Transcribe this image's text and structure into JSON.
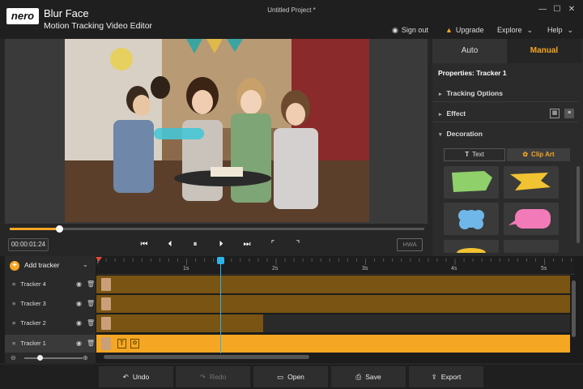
{
  "window": {
    "logo": "nero",
    "app_name": "Blur Face",
    "app_subtitle": "Motion Tracking Video Editor",
    "doc_title": "Untitled Project *",
    "controls": {
      "minimize": "—",
      "maximize": "☐",
      "close": "✕"
    }
  },
  "topnav": {
    "sign_out": "Sign out",
    "upgrade": "Upgrade",
    "explore": "Explore",
    "help": "Help"
  },
  "player": {
    "timecode": "00:00:01:24",
    "hwa": "HWA",
    "progress": 0.12
  },
  "panel": {
    "tab_auto": "Auto",
    "tab_manual": "Manual",
    "properties_title": "Properties: Tracker 1",
    "sections": {
      "tracking_options": "Tracking Options",
      "effect": "Effect",
      "decoration": "Decoration"
    },
    "subtab_text": "Text",
    "subtab_clipart": "Clip Art"
  },
  "timeline": {
    "add_tracker": "Add tracker",
    "ticks": [
      "1s",
      "2s",
      "3s",
      "4s",
      "5s"
    ],
    "tracks": [
      {
        "label": "Tracker 4"
      },
      {
        "label": "Tracker 3"
      },
      {
        "label": "Tracker 2"
      },
      {
        "label": "Tracker 1"
      }
    ]
  },
  "bottom": {
    "undo": "Undo",
    "redo": "Redo",
    "open": "Open",
    "save": "Save",
    "export": "Export"
  },
  "colors": {
    "accent": "#f5a623",
    "playhead": "#2fb3e8",
    "track_bar": "#7a5413",
    "selected_track": "#f5a623"
  }
}
